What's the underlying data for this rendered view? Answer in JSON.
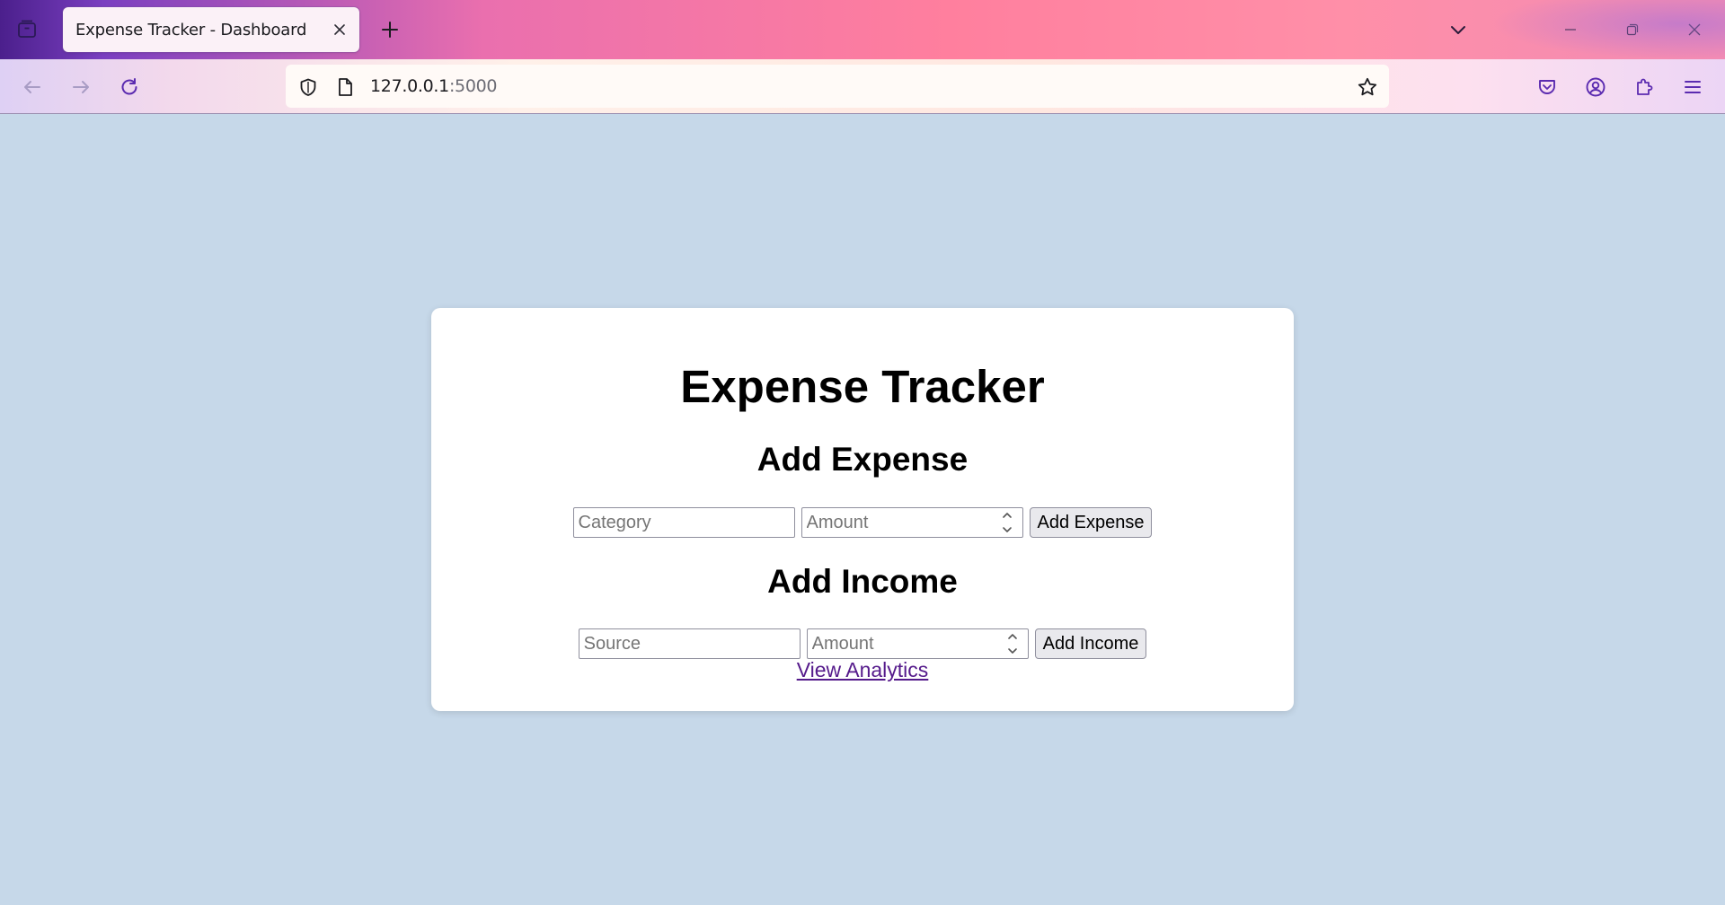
{
  "browser": {
    "tab": {
      "title": "Expense Tracker - Dashboard"
    },
    "url": {
      "host": "127.0.0.1",
      "port": ":5000"
    }
  },
  "page": {
    "title": "Expense Tracker",
    "expense_section": {
      "heading": "Add Expense",
      "category_placeholder": "Category",
      "amount_placeholder": "Amount",
      "button_label": "Add Expense"
    },
    "income_section": {
      "heading": "Add Income",
      "source_placeholder": "Source",
      "amount_placeholder": "Amount",
      "button_label": "Add Income"
    },
    "analytics_link": "View Analytics"
  },
  "colors": {
    "page_background": "#c6d8e9",
    "card_background": "#ffffff",
    "link_visited": "#551a8b",
    "browser_accent": "#5b2bb0"
  },
  "icons": {
    "tab_list": "tab-list-icon",
    "tab_close": "close-icon",
    "new_tab": "plus-icon",
    "list_all_tabs": "chevron-down-icon",
    "minimize": "minimize-icon",
    "restore": "restore-icon",
    "close_window": "close-icon",
    "back": "back-arrow-icon",
    "forward": "forward-arrow-icon",
    "reload": "reload-icon",
    "tracking_protection": "shield-icon",
    "page_info": "page-icon",
    "bookmark": "star-icon",
    "pocket": "pocket-icon",
    "account": "account-icon",
    "extensions": "puzzle-icon",
    "menu": "hamburger-menu-icon"
  }
}
